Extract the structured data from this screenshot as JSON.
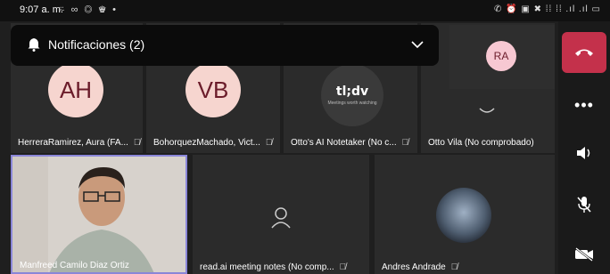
{
  "status_bar": {
    "time": "9:07 a. m.",
    "left_icons": "⍨ ∞ ◎ ♛ •",
    "right_icons": "✆ ⏰ ▣ ✖ ⁞⁞ ⁞⁞ .ıl .ıl ▭"
  },
  "notification": {
    "label": "Notificaciones (2)"
  },
  "participants": [
    {
      "initials": "AH",
      "name": "HerreraRamirez, Aura (FA...",
      "muted": true
    },
    {
      "initials": "VB",
      "name": "BohorquezMachado, Vict...",
      "muted": true
    },
    {
      "name": "Otto's AI Notetaker (No c...",
      "muted": true,
      "logo": "tl;dv",
      "logo_sub": "Meetings worth watching"
    },
    {
      "name": "Otto Vila (No comprobado)",
      "muted": false
    },
    {
      "name": "Manfreed Camilo Diaz Ortiz",
      "muted": false
    },
    {
      "name": "read.ai meeting notes (No comp...",
      "muted": true
    },
    {
      "name": "Andres Andrade",
      "muted": true
    }
  ],
  "self_view": {
    "initials": "RA"
  },
  "colors": {
    "end_call": "#c4314b",
    "avatar_bg": "#f6d5cf",
    "avatar_text": "#6b1c2a",
    "self_avatar_bg": "#f7c8d2",
    "tile_bg": "#2b2b2b",
    "active_border": "#8a86d8"
  },
  "icons": {
    "notification": "bell-icon",
    "expand": "chevron-down-icon",
    "end_call": "phone-hangup-icon",
    "more": "more-icon",
    "speaker": "speaker-icon",
    "mic": "mic-off-icon",
    "camera": "camera-off-icon"
  }
}
